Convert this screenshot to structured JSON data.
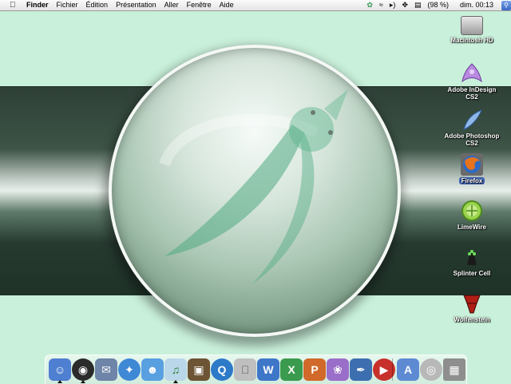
{
  "menubar": {
    "apple_icon": "apple-icon",
    "app_name": "Finder",
    "menus": [
      "Fichier",
      "Édition",
      "Présentation",
      "Aller",
      "Fenêtre",
      "Aide"
    ],
    "battery": "(98 %)",
    "clock": "dim. 00:13",
    "status_icons": [
      "bug-icon",
      "wifi-icon",
      "volume-icon",
      "sync-icon",
      "display-icon",
      "spotlight-icon"
    ]
  },
  "desktop": {
    "icons": [
      {
        "label": "Macintosh HD",
        "icon": "hard-drive-icon"
      },
      {
        "label": "Adobe InDesign CS2",
        "icon": "indesign-icon"
      },
      {
        "label": "Adobe Photoshop CS2",
        "icon": "photoshop-icon"
      },
      {
        "label": "Firefox",
        "icon": "firefox-icon"
      },
      {
        "label": "LimeWire",
        "icon": "limewire-icon"
      },
      {
        "label": "Splinter Cell",
        "icon": "splinter-cell-icon"
      },
      {
        "label": "Wolfenstein",
        "icon": "wolfenstein-icon"
      }
    ]
  },
  "colors": {
    "wallpaper_bg": "#c9f0da",
    "band_dark": "#2e4037",
    "selection": "#3f63b6"
  },
  "dock": {
    "items": [
      {
        "icon": "finder-icon",
        "color": "#4f7fd0"
      },
      {
        "icon": "dashboard-icon",
        "color": "#2b2b2b"
      },
      {
        "icon": "mail-stamp-icon",
        "color": "#6e84a8"
      },
      {
        "icon": "safari-icon",
        "color": "#3f88d6"
      },
      {
        "icon": "messenger-icon",
        "color": "#58a0e0"
      },
      {
        "icon": "itunes-icon",
        "color": "#b9d7e8"
      },
      {
        "icon": "iphoto-icon",
        "color": "#6c5434"
      },
      {
        "icon": "quicktime-icon",
        "color": "#2d7ac8"
      },
      {
        "icon": "apple-system-icon",
        "color": "#bfbfbf"
      },
      {
        "icon": "word-icon",
        "color": "#3e76c8"
      },
      {
        "icon": "excel-icon",
        "color": "#3a9a4e"
      },
      {
        "icon": "powerpoint-icon",
        "color": "#d0692a"
      },
      {
        "icon": "indesign-dock-icon",
        "color": "#9a6fc9"
      },
      {
        "icon": "photoshop-dock-icon",
        "color": "#3d6fb0"
      },
      {
        "icon": "red-app-icon",
        "color": "#c8312b"
      },
      {
        "icon": "applications-folder-icon",
        "color": "#5e8ad3"
      },
      {
        "icon": "network-icon",
        "color": "#b8b8b8"
      },
      {
        "icon": "trash-icon",
        "color": "#8e8e8e"
      }
    ]
  }
}
